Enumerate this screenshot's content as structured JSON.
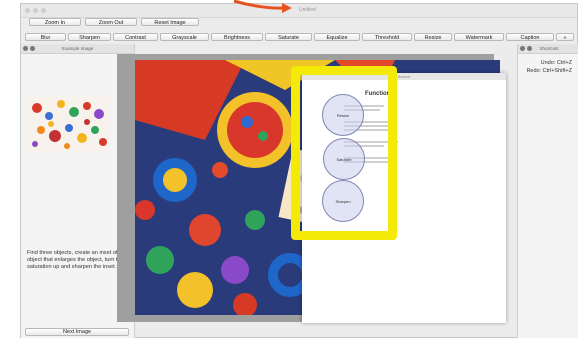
{
  "window": {
    "title": "Untitled"
  },
  "toolbar_top": [
    {
      "label": "Zoom In"
    },
    {
      "label": "Zoom Out"
    },
    {
      "label": "Reset Image"
    }
  ],
  "toolbar_filters": [
    {
      "label": "Blur"
    },
    {
      "label": "Sharpen"
    },
    {
      "label": "Contrast"
    },
    {
      "label": "Grayscale"
    },
    {
      "label": "Brightness"
    },
    {
      "label": "Saturate"
    },
    {
      "label": "Equalize"
    },
    {
      "label": "Threshold"
    },
    {
      "label": "Resize"
    },
    {
      "label": "Watermark"
    },
    {
      "label": "Caption"
    },
    {
      "label": "»"
    }
  ],
  "left_panel": {
    "title": "Example Image",
    "instructions": "Find three objects, create an inset of the object that enlarges the object, turn the saturation up and sharpen the inset.",
    "next_button": "Next Image"
  },
  "right_panel": {
    "title": "Shortcuts",
    "undo": "Undo:  Ctrl+Z",
    "redo": "Redo:  Ctrl+Shift+Z"
  },
  "document": {
    "bar_label": "Search",
    "title": "Functions",
    "circles": [
      {
        "label": "Resize"
      },
      {
        "label": "Saturate"
      },
      {
        "label": "Sharpen"
      }
    ]
  },
  "colors": {
    "highlight": "#f4ea08",
    "accent_arrow": "#e8521f"
  }
}
